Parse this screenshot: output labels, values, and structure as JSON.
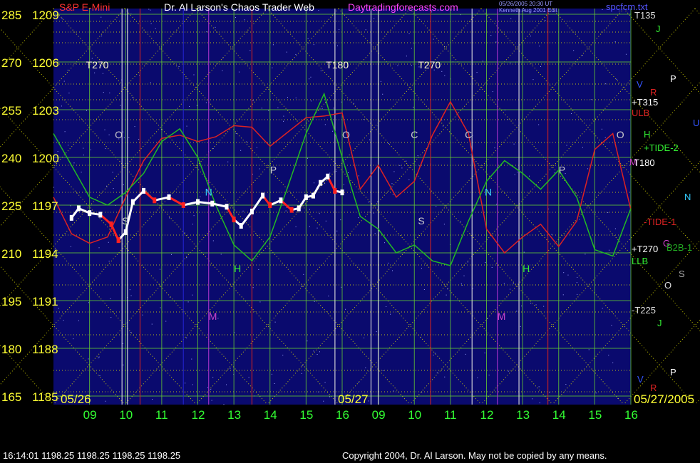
{
  "header": {
    "instrument": "S&P E-Mini",
    "title": "Dr. Al Larson's Chaos Trader Web",
    "site": "Daytradingforecasts.com",
    "stamp_line1": "05/26/2005 20:30 UT",
    "stamp_line2": "Kenneth Aug 2001 Edit",
    "filename": "spcfcm.txt"
  },
  "status_bar": {
    "readout": "16:14:01  1198.25 1198.25 1198.25 1198.25",
    "copyright": "Copyright 2004, Dr. Al Larson. May not be copied by any means."
  },
  "colors": {
    "background": "#000000",
    "plot_bg": "#0a0a6e",
    "price_bar": "#ffffff",
    "down_bar": "#ff2020",
    "grid": "#66cc33",
    "dotted": "#e6e600",
    "axis_label": "#ffff33",
    "time_label": "#33ff33",
    "flux_red": "#dd2222",
    "flux_green": "#22bb22"
  },
  "chart_data": {
    "type": "line",
    "title": "Dr. Al Larson's Chaos Trader Web",
    "y_left_outer": [
      285,
      270,
      255,
      240,
      225,
      210,
      195,
      180,
      165
    ],
    "y_left_inner": [
      1209,
      1206,
      1203,
      1200,
      1197,
      1194,
      1191,
      1188,
      1185
    ],
    "ylim": [
      1185,
      1209
    ],
    "x_ticks": [
      "09",
      "10",
      "11",
      "12",
      "13",
      "14",
      "15",
      "16",
      "09",
      "10",
      "11",
      "12",
      "13",
      "14",
      "15",
      "16"
    ],
    "date_labels": [
      "05/26",
      "05/27",
      "05/27/2005"
    ],
    "price_series": {
      "name": "S&P E-Mini",
      "x": [
        8.5,
        8.7,
        9.0,
        9.3,
        9.6,
        9.8,
        10.0,
        10.2,
        10.5,
        10.8,
        11.2,
        11.6,
        12.0,
        12.4,
        12.8,
        13.0,
        13.2,
        13.5,
        13.8,
        14.0,
        14.3,
        14.6,
        14.8,
        15.0,
        15.2,
        15.4,
        15.6,
        15.8,
        16.0
      ],
      "y": [
        1196.2,
        1196.8,
        1196.5,
        1196.4,
        1195.8,
        1194.8,
        1195.3,
        1197.2,
        1197.9,
        1197.3,
        1197.5,
        1197.0,
        1197.2,
        1197.1,
        1196.9,
        1196.1,
        1195.7,
        1196.6,
        1197.6,
        1197.0,
        1197.3,
        1196.7,
        1196.8,
        1197.5,
        1197.6,
        1198.4,
        1198.8,
        1197.9,
        1197.8
      ]
    },
    "flux_lines": [
      {
        "name": "red",
        "x": [
          8.0,
          8.5,
          9.0,
          9.5,
          10.0,
          10.5,
          11.0,
          11.5,
          12.0,
          12.5,
          13.0,
          13.5,
          14.0,
          14.5,
          15.0,
          15.5,
          16.0,
          16.5,
          17.0,
          17.5,
          18.0,
          18.5,
          19.0,
          19.5,
          20.0,
          20.5,
          21.0,
          21.5,
          22.0,
          22.5,
          23.0,
          23.5,
          24.0
        ],
        "y": [
          1197.5,
          1195.2,
          1194.6,
          1195.0,
          1197.5,
          1199.8,
          1201.2,
          1201.4,
          1201.0,
          1201.3,
          1202.0,
          1201.9,
          1200.7,
          1201.6,
          1202.5,
          1202.6,
          1202.8,
          1198.0,
          1199.5,
          1197.5,
          1198.5,
          1201.4,
          1203.5,
          1201.5,
          1195.5,
          1194.0,
          1195.0,
          1195.8,
          1194.4,
          1196.0,
          1200.5,
          1201.5,
          1196.7
        ]
      },
      {
        "name": "green",
        "x": [
          8.0,
          8.5,
          9.0,
          9.5,
          10.0,
          10.5,
          11.0,
          11.5,
          12.0,
          12.5,
          13.0,
          13.5,
          14.0,
          14.5,
          15.0,
          15.5,
          16.0,
          16.5,
          17.0,
          17.5,
          18.0,
          18.5,
          19.0,
          19.5,
          20.0,
          20.5,
          21.0,
          21.5,
          22.0,
          22.5,
          23.0,
          23.5,
          24.0
        ],
        "y": [
          1201.5,
          1199.5,
          1197.5,
          1197.0,
          1197.8,
          1199.0,
          1201.0,
          1201.8,
          1200.0,
          1197.0,
          1194.5,
          1193.5,
          1195.0,
          1198.2,
          1201.5,
          1204.0,
          1200.0,
          1196.3,
          1195.5,
          1194.0,
          1194.5,
          1193.5,
          1193.2,
          1196.0,
          1198.5,
          1199.8,
          1199.0,
          1198.0,
          1199.2,
          1197.5,
          1194.2,
          1193.8,
          1196.8
        ]
      }
    ],
    "annotations_center": [
      "T270",
      "T180",
      "T270",
      "O",
      "O",
      "C",
      "C",
      "O",
      "S",
      "S",
      "N",
      "N",
      "P",
      "P",
      "H",
      "H",
      "M",
      "M"
    ],
    "annotations_right": [
      "T135",
      "J",
      "V",
      "P",
      "R",
      "+T315",
      "ULB",
      "U",
      "H",
      "+TIDE-2",
      "M",
      "T180",
      "N",
      "-TIDE-1",
      "G",
      "B2B-1",
      "+T270",
      "LLB",
      "S",
      "O",
      "-T225",
      "J",
      "V",
      "P",
      "R"
    ],
    "grid": true
  }
}
